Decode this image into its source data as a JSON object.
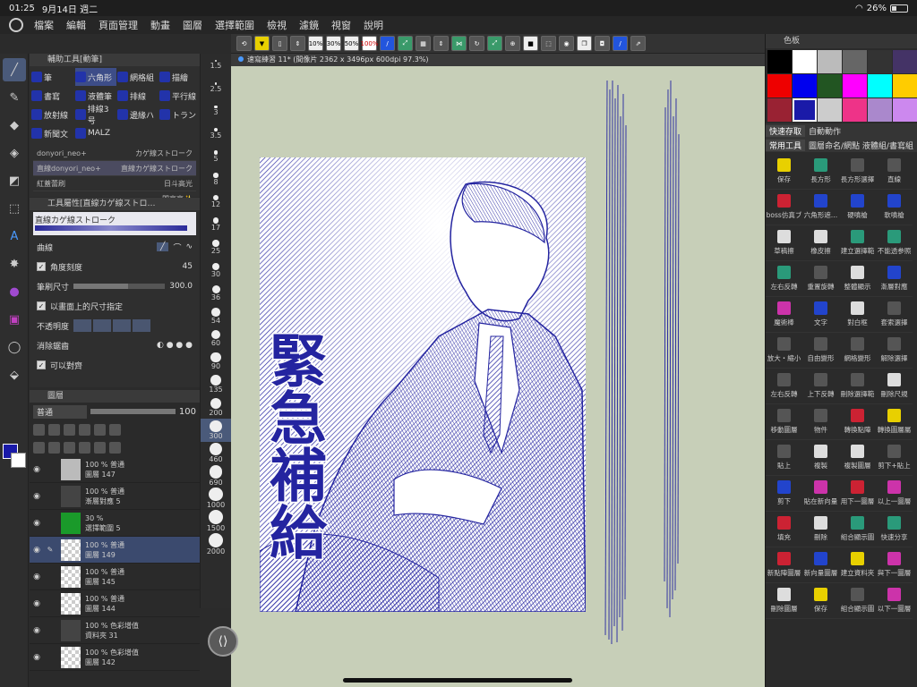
{
  "status": {
    "time": "01:25",
    "date": "9月14日 週二",
    "battery": "26%"
  },
  "menu": [
    "檔案",
    "編輯",
    "頁面管理",
    "動畫",
    "圖層",
    "選擇範圍",
    "檢視",
    "濾鏡",
    "視窗",
    "說明"
  ],
  "toolbar_labels": [
    "10%",
    "30%",
    "50%",
    "100%"
  ],
  "doc_title": "速寫練習 11* (間像片 2362 x 3496px 600dpi 97.3%)",
  "subtool": {
    "title": "輔助工具[動筆]",
    "items": [
      {
        "label": "筆",
        "active": false
      },
      {
        "label": "六角形",
        "active": true
      },
      {
        "label": "網格組",
        "active": false
      },
      {
        "label": "描繪",
        "active": false
      },
      {
        "label": "書寫",
        "active": false
      },
      {
        "label": "液體筆",
        "active": false
      },
      {
        "label": "排線",
        "active": false
      },
      {
        "label": "平行線",
        "active": false
      },
      {
        "label": "放射線",
        "active": false
      },
      {
        "label": "排線3号",
        "active": false
      },
      {
        "label": "邊緣ハ",
        "active": false
      },
      {
        "label": "トラン",
        "active": false
      },
      {
        "label": "新聞文",
        "active": false
      },
      {
        "label": "MALZ",
        "active": false
      }
    ],
    "brushes": [
      {
        "left": "donyori_neo+",
        "right": "カゲ線ストローク",
        "sel": false
      },
      {
        "left": "直線donyori_neo+",
        "right": "直線カゲ線ストローク",
        "sel": true
      },
      {
        "left": "紅蓋蕾刷",
        "right": "日斗高光",
        "sel": false
      },
      {
        "left": "",
        "right": "閃亮亮✨",
        "sel": false
      }
    ]
  },
  "sizes": [
    "1.5",
    "2.5",
    "3",
    "3.5",
    "5",
    "8",
    "12",
    "17",
    "25",
    "30",
    "36",
    "54",
    "60",
    "90",
    "135",
    "200",
    "300",
    "460",
    "690",
    "1000",
    "1500",
    "2000"
  ],
  "selected_size": "300",
  "toolprop": {
    "title": "工具屬性[直線カゲ線ストロ…",
    "brush_name": "直線カゲ線ストローク",
    "curve_label": "曲線",
    "angle_label": "角度刻度",
    "angle_value": "45",
    "size_label": "筆刷尺寸",
    "size_value": "300.0",
    "screen_size_label": "以畫面上的尺寸指定",
    "opacity_label": "不透明度",
    "aa_label": "消除鋸齒",
    "snap_label": "可以對齊"
  },
  "layers": {
    "title": "圖層",
    "blend": "普通",
    "opacity": "100",
    "rows": [
      {
        "pct": "100 % 普通",
        "name": "圖層 147",
        "thumb": "photo",
        "sel": false,
        "indent": false
      },
      {
        "pct": "100 % 普通",
        "name": "漸層對應 5",
        "thumb": "dark",
        "sel": false,
        "indent": false
      },
      {
        "pct": "30 %",
        "name": "選擇範圍 5",
        "thumb": "green",
        "sel": false,
        "indent": false
      },
      {
        "pct": "100 % 普通",
        "name": "圖層 149",
        "thumb": "checker",
        "sel": true,
        "indent": false
      },
      {
        "pct": "100 % 普通",
        "name": "圖層 145",
        "thumb": "checker",
        "sel": false,
        "indent": false
      },
      {
        "pct": "100 % 普通",
        "name": "圖層 144",
        "thumb": "checker",
        "sel": false,
        "indent": false
      },
      {
        "pct": "100 % 色彩增值",
        "name": "資料夾 31",
        "thumb": "folder",
        "sel": false,
        "indent": false
      },
      {
        "pct": "100 % 色彩增值",
        "name": "圖層 142",
        "thumb": "checker",
        "sel": false,
        "indent": false
      }
    ]
  },
  "sfx_text": "緊急補給",
  "color_panel": {
    "title": "色板",
    "swatches": [
      "#000000",
      "#ffffff",
      "#bbbbbb",
      "#666666",
      "#333333",
      "#443366",
      "#ee0000",
      "#0000ee",
      "#225522",
      "#ff00ff",
      "#00ffff",
      "#ffcc00",
      "#992233",
      "#1a1aa8",
      "#cccccc",
      "#ee3388",
      "#aa88cc",
      "#cc88ee"
    ],
    "selected_index": 13
  },
  "quick_access": {
    "tabs": [
      "快速存取",
      "自動動作"
    ],
    "subtabs": [
      "常用工具",
      "圖層命名/網點 液體組/書寫組"
    ],
    "items": [
      {
        "label": "保存",
        "c": "y"
      },
      {
        "label": "長方形",
        "c": "g"
      },
      {
        "label": "長方形選擇",
        "c": ""
      },
      {
        "label": "直線",
        "c": ""
      },
      {
        "label": "boss仿真ブ",
        "c": "r"
      },
      {
        "label": "六角形遮…",
        "c": "b"
      },
      {
        "label": "硬噴槍",
        "c": "b"
      },
      {
        "label": "軟噴槍",
        "c": "b"
      },
      {
        "label": "草稿擦",
        "c": "w"
      },
      {
        "label": "橡皮擦",
        "c": "w"
      },
      {
        "label": "建立選擇範",
        "c": "g"
      },
      {
        "label": "不能透参照",
        "c": "g"
      },
      {
        "label": "左右反轉",
        "c": "g"
      },
      {
        "label": "重置旋轉",
        "c": ""
      },
      {
        "label": "整體顯示",
        "c": "w"
      },
      {
        "label": "漸層對應",
        "c": "b"
      },
      {
        "label": "魔術棒",
        "c": "p"
      },
      {
        "label": "文字",
        "c": "b"
      },
      {
        "label": "對白框",
        "c": "w"
      },
      {
        "label": "套索選擇",
        "c": ""
      },
      {
        "label": "放大・縮小",
        "c": ""
      },
      {
        "label": "自由變形",
        "c": ""
      },
      {
        "label": "網格變形",
        "c": ""
      },
      {
        "label": "解除選擇",
        "c": ""
      },
      {
        "label": "左右反轉",
        "c": ""
      },
      {
        "label": "上下反轉",
        "c": ""
      },
      {
        "label": "刪除選擇範",
        "c": ""
      },
      {
        "label": "刪除尺規",
        "c": "w"
      },
      {
        "label": "移動圖層",
        "c": ""
      },
      {
        "label": "物件",
        "c": ""
      },
      {
        "label": "轉換點陣",
        "c": "r"
      },
      {
        "label": "轉換圖層屬",
        "c": "y"
      },
      {
        "label": "貼上",
        "c": ""
      },
      {
        "label": "複製",
        "c": "w"
      },
      {
        "label": "複製圖層",
        "c": "w"
      },
      {
        "label": "剪下+貼上",
        "c": ""
      },
      {
        "label": "剪下",
        "c": "b"
      },
      {
        "label": "貼在新向量",
        "c": "p"
      },
      {
        "label": "用下一圖層",
        "c": "r"
      },
      {
        "label": "以上一圖層",
        "c": "p"
      },
      {
        "label": "填充",
        "c": "r"
      },
      {
        "label": "刪除",
        "c": "w"
      },
      {
        "label": "組合顯示圖",
        "c": "g"
      },
      {
        "label": "快速分享",
        "c": "g"
      },
      {
        "label": "新點陣圖層",
        "c": "r"
      },
      {
        "label": "新向量圖層",
        "c": "b"
      },
      {
        "label": "建立資料夾",
        "c": "y"
      },
      {
        "label": "與下一圖層",
        "c": "p"
      },
      {
        "label": "刪除圖層",
        "c": "w"
      },
      {
        "label": "保存",
        "c": "y"
      },
      {
        "label": "組合顯示圖",
        "c": ""
      },
      {
        "label": "以下一圖層",
        "c": "p"
      }
    ]
  }
}
